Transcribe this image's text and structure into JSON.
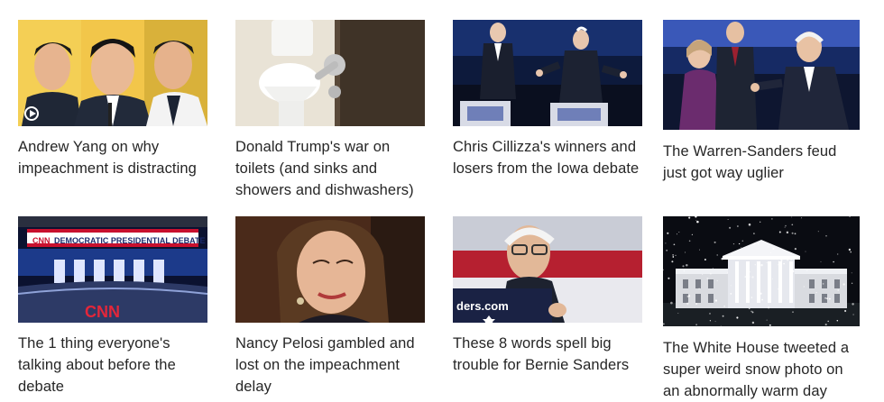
{
  "stories": [
    {
      "headline": "Andrew Yang on why impeachment is distracting",
      "has_video": true
    },
    {
      "headline": "Donald Trump's war on toilets (and sinks and showers and dishwashers)",
      "has_video": false
    },
    {
      "headline": "Chris Cillizza's winners and losers from the Iowa debate",
      "has_video": false
    },
    {
      "headline": "The Warren-Sanders feud just got way uglier",
      "has_video": false
    },
    {
      "headline": "The 1 thing everyone's talking about before the debate",
      "has_video": false
    },
    {
      "headline": "Nancy Pelosi gambled and lost on the impeachment delay",
      "has_video": false
    },
    {
      "headline": "These 8 words spell big trouble for Bernie Sanders",
      "has_video": false
    },
    {
      "headline": "The White House tweeted a super weird snow photo on an abnormally warm day",
      "has_video": false
    }
  ],
  "image_text": {
    "debate_banner": "DEMOCRATIC PRESIDENTIAL DEBATE",
    "cnn_logo": "CNN",
    "podium_sign": "ders.com"
  },
  "icons": {
    "play": "play-circle-icon"
  }
}
